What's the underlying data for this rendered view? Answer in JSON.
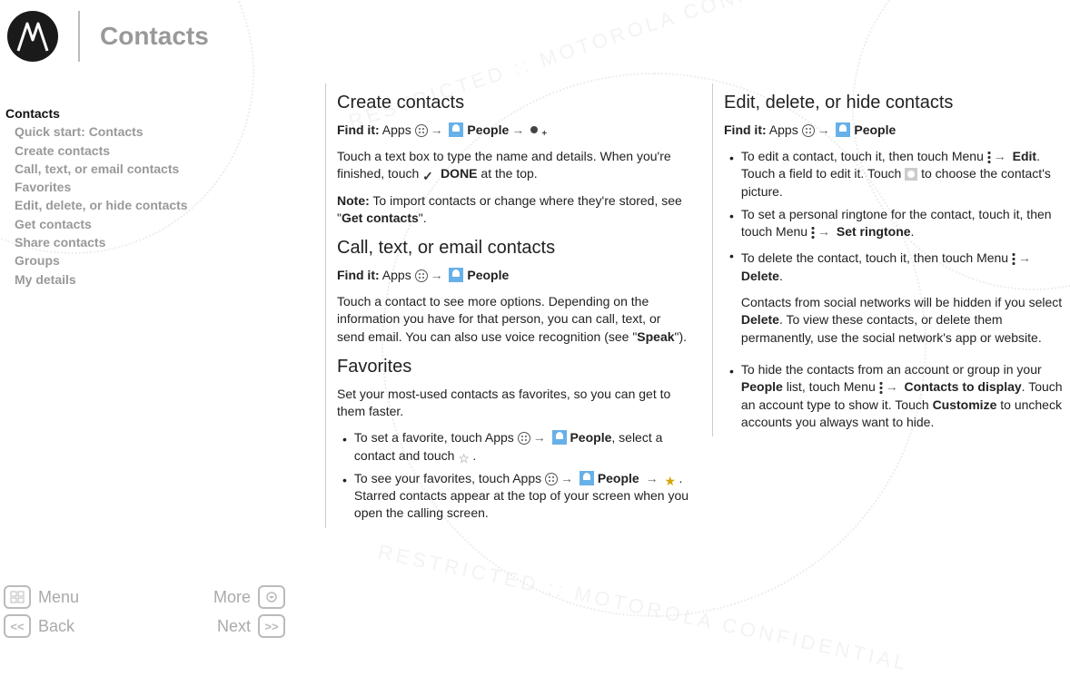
{
  "header": {
    "title": "Contacts"
  },
  "sidebar": {
    "head": "Contacts",
    "items": [
      "Quick start: Contacts",
      "Create contacts",
      "Call, text, or email contacts",
      "Favorites",
      "Edit, delete, or hide contacts",
      "Get contacts",
      "Share contacts",
      "Groups",
      "My details"
    ]
  },
  "bottom_nav": {
    "menu": "Menu",
    "more": "More",
    "back": "Back",
    "next": "Next"
  },
  "labels": {
    "find_it": "Find it:",
    "apps": "Apps",
    "people": "People",
    "done": "DONE",
    "note": "Note:"
  },
  "col1": {
    "s1_title": "Create contacts",
    "s1_p1a": "Touch a text box to type the name and details. When you're finished, touch ",
    "s1_p1b": " at the top.",
    "s1_note_a": " To import contacts or change where they're stored, see \"",
    "s1_note_link": "Get contacts",
    "s1_note_b": "\".",
    "s2_title": "Call, text, or email contacts",
    "s2_p1a": "Touch a contact to see more options. Depending on the information you have for that person, you can call, text, or send email. You can also use voice recognition (see \"",
    "s2_p1_link": "Speak",
    "s2_p1b": "\").",
    "s3_title": "Favorites",
    "s3_p1": "Set your most-used contacts as favorites, so you can get to them faster.",
    "s3_b1a": "To set a favorite, touch Apps ",
    "s3_b1b": ", select a contact and touch ",
    "s3_b1c": ".",
    "s3_b2a": "To see your favorites, touch Apps ",
    "s3_b2b": ". Starred contacts appear at the top of your screen when you open the calling screen."
  },
  "col2": {
    "s1_title": "Edit, delete, or hide contacts",
    "b1a": "To edit a contact, touch it, then touch Menu ",
    "b1_edit": "Edit",
    "b1b": ". Touch a field to edit it. Touch ",
    "b1c": " to choose the contact's picture.",
    "b2a": "To set a personal ringtone for the contact, touch it, then touch Menu ",
    "b2_set": "Set ringtone",
    "b2b": ".",
    "b3a": "To delete the contact, touch it, then touch Menu ",
    "b3_del": "Delete",
    "b3b": ".",
    "b3_p2a": "Contacts from social networks will be hidden if you select ",
    "b3_p2_del": "Delete",
    "b3_p2b": ". To view these contacts, or delete them permanently, use the social network's app or website.",
    "b4a": "To hide the contacts from an account or group in your ",
    "b4_people": "People",
    "b4b": " list, touch Menu ",
    "b4_ctd": "Contacts to display",
    "b4c": ". Touch an account type to show it. Touch ",
    "b4_cust": "Customize",
    "b4d": " to uncheck accounts you always want to hide."
  }
}
